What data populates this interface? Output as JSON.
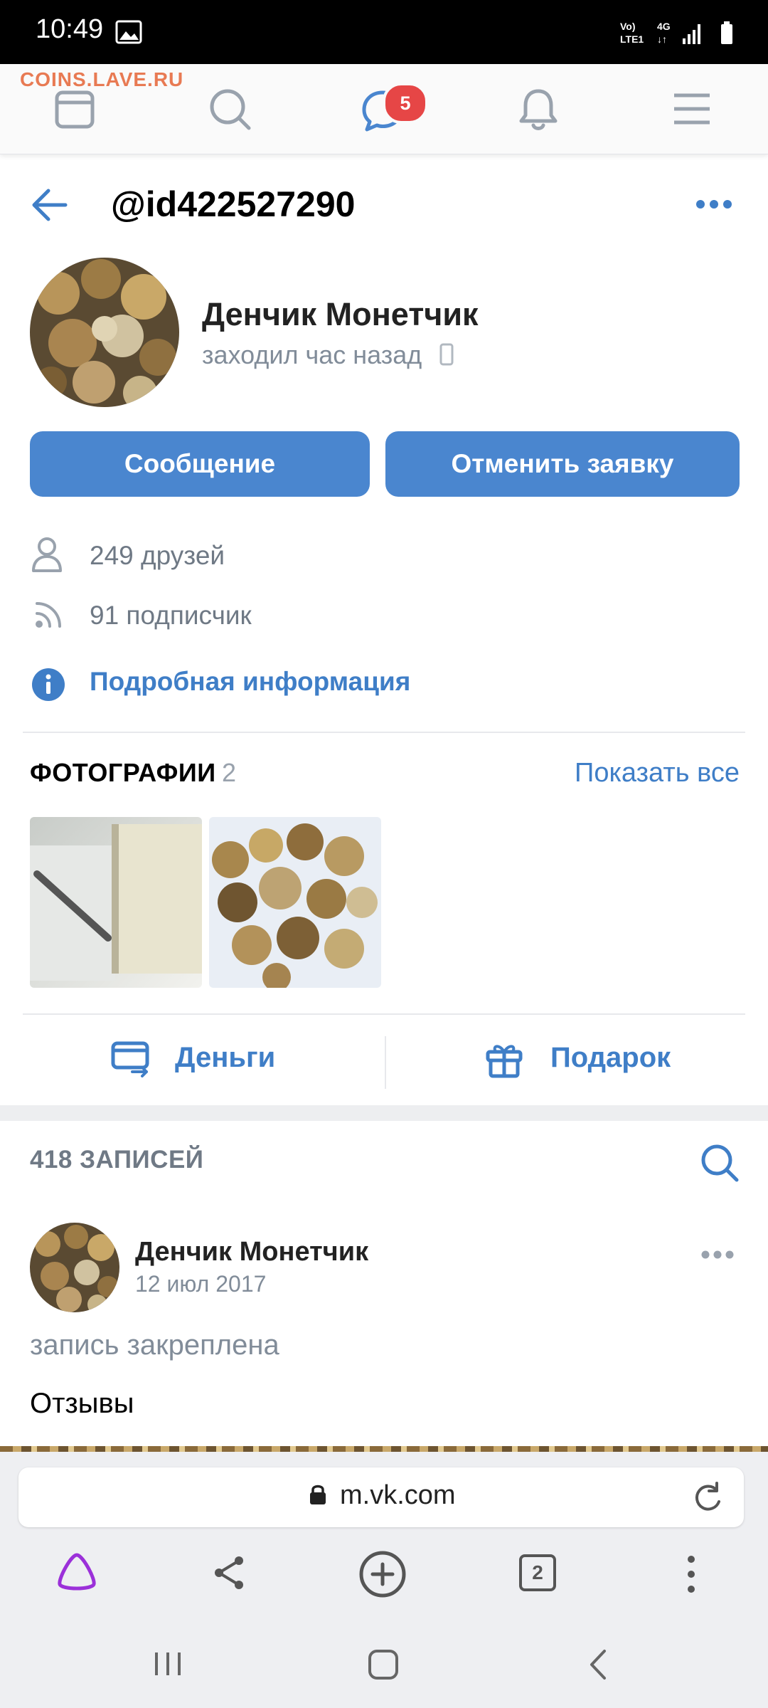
{
  "status_bar": {
    "time": "10:49"
  },
  "watermark": "COINS.LAVE.RU",
  "top_nav": {
    "messages_badge": "5"
  },
  "profile": {
    "handle": "@id422527290",
    "name": "Денчик Монетчик",
    "last_seen": "заходил час назад",
    "buttons": {
      "message": "Сообщение",
      "cancel_request": "Отменить заявку"
    },
    "friends": "249 друзей",
    "followers": "91 подписчик",
    "details_link": "Подробная информация"
  },
  "photos": {
    "title": "ФОТОГРАФИИ",
    "count": "2",
    "show_all": "Показать все"
  },
  "actions": {
    "money": "Деньги",
    "gift": "Подарок"
  },
  "wall": {
    "posts_count": "418 ЗАПИСЕЙ",
    "post": {
      "author": "Денчик Монетчик",
      "date": "12 июл 2017",
      "pinned": "запись закреплена",
      "text": "Отзывы"
    }
  },
  "browser": {
    "url": "m.vk.com",
    "tabs": "2"
  },
  "colors": {
    "accent": "#4a86cf",
    "link": "#3f7ec7",
    "badge": "#e64646",
    "secondary_text": "#818c99"
  }
}
